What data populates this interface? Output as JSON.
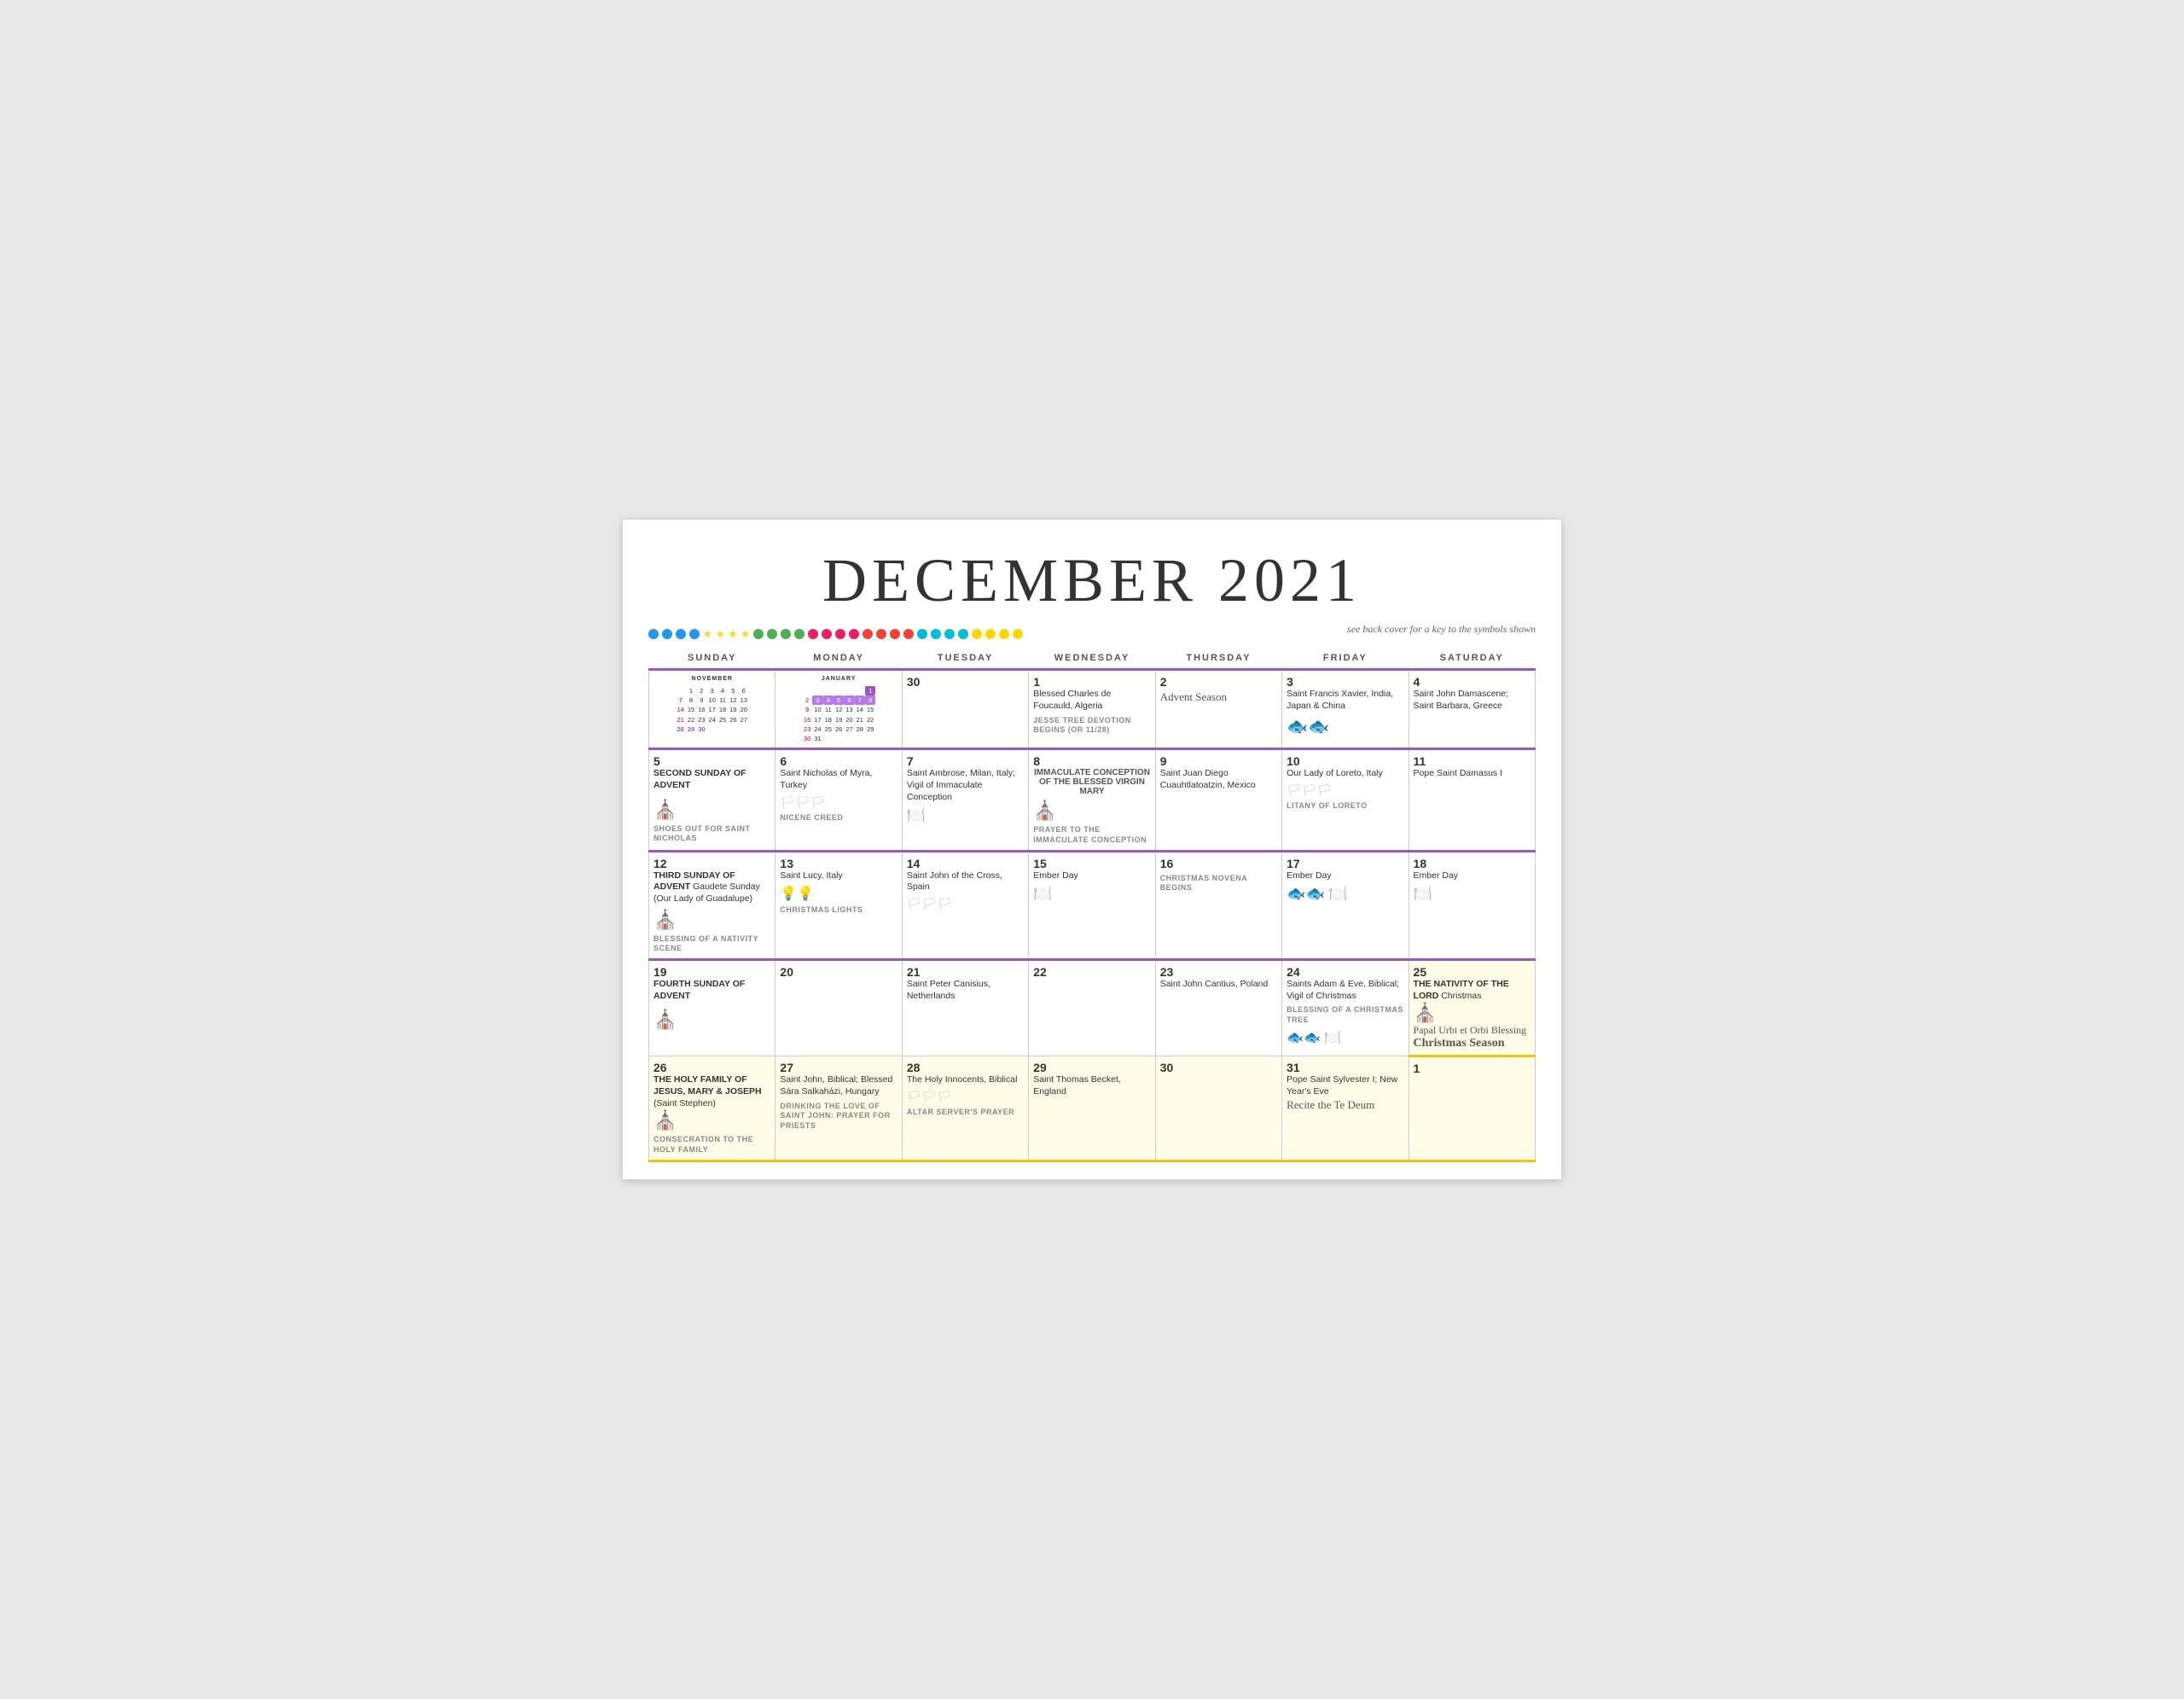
{
  "title": "DECEMBER 2021",
  "back_cover_note": "see back cover for a key to the symbols shown",
  "dots": [
    {
      "color": "#2196F3"
    },
    {
      "color": "#2196F3"
    },
    {
      "color": "#2196F3"
    },
    {
      "color": "#2196F3"
    },
    {
      "color": "#FFD700",
      "type": "star"
    },
    {
      "color": "#FFD700",
      "type": "star"
    },
    {
      "color": "#FFD700",
      "type": "star"
    },
    {
      "color": "#FFD700",
      "type": "star"
    },
    {
      "color": "#4CAF50"
    },
    {
      "color": "#4CAF50"
    },
    {
      "color": "#4CAF50"
    },
    {
      "color": "#4CAF50"
    },
    {
      "color": "#E91E63"
    },
    {
      "color": "#E91E63"
    },
    {
      "color": "#E91E63"
    },
    {
      "color": "#E91E63"
    },
    {
      "color": "#F44336"
    },
    {
      "color": "#F44336"
    },
    {
      "color": "#F44336"
    },
    {
      "color": "#F44336"
    },
    {
      "color": "#00BCD4"
    },
    {
      "color": "#00BCD4"
    },
    {
      "color": "#00BCD4"
    },
    {
      "color": "#00BCD4"
    },
    {
      "color": "#FFD700"
    },
    {
      "color": "#FFD700"
    },
    {
      "color": "#FFD700"
    },
    {
      "color": "#FFD700"
    }
  ],
  "headers": [
    "SUNDAY",
    "MONDAY",
    "TUESDAY",
    "WEDNESDAY",
    "THURSDAY",
    "FRIDAY",
    "SATURDAY"
  ],
  "weeks": [
    {
      "cells": [
        {
          "day": "",
          "mini_month": "NOVEMBER",
          "mini_rows": [
            [
              "",
              "1",
              "2",
              "3",
              "4",
              "5",
              "6"
            ],
            [
              "7",
              "8",
              "9",
              "10",
              "11",
              "12",
              "13"
            ],
            [
              "14",
              "15",
              "16",
              "17",
              "18",
              "19",
              "20"
            ],
            [
              "21",
              "22",
              "23",
              "24",
              "25",
              "26",
              "27"
            ],
            [
              "28",
              "29",
              "30",
              "",
              "",
              "",
              ""
            ]
          ],
          "sunday_col": 0
        },
        {
          "day": "",
          "mini_month": "JANUARY",
          "mini_rows": [
            [
              "",
              "",
              "",
              "",
              "",
              "",
              "1"
            ],
            [
              "2",
              "3",
              "4",
              "5",
              "6",
              "7",
              "8"
            ],
            [
              "9",
              "10",
              "11",
              "12",
              "13",
              "14",
              "15"
            ],
            [
              "16",
              "17",
              "18",
              "19",
              "20",
              "21",
              "22"
            ],
            [
              "23",
              "24",
              "25",
              "26",
              "27",
              "28",
              "29"
            ],
            [
              "30",
              "31",
              "",
              "",
              "",
              "",
              ""
            ]
          ],
          "highlight_col": 6,
          "highlight_row": 0,
          "purple_row": 1,
          "sunday_col": 0
        },
        {
          "day": "30",
          "saint": "",
          "activity": "",
          "icons": []
        },
        {
          "day": "1",
          "saint": "Blessed Charles de Foucauld, Algeria",
          "activity": "JESSE TREE DEVOTION BEGINS (OR 11/28)",
          "icons": []
        },
        {
          "day": "2",
          "saint": "",
          "cursive": "Advent Season",
          "icons": []
        },
        {
          "day": "3",
          "saint": "Saint Francis Xavier, India, Japan & China",
          "icons": [
            "fish"
          ]
        },
        {
          "day": "4",
          "saint": "Saint John Damascene; Saint Barbara, Greece",
          "icons": []
        }
      ],
      "border": "advent"
    },
    {
      "cells": [
        {
          "day": "5",
          "saint": "SECOND SUNDAY OF ADVENT",
          "activity": "SHOES OUT FOR SAINT NICHOLAS",
          "icons": [
            "church"
          ]
        },
        {
          "day": "6",
          "saint": "Saint Nicholas of Myra, Turkey",
          "activity": "NICENE CREED",
          "icons": [
            "pennants"
          ]
        },
        {
          "day": "7",
          "saint": "Saint Ambrose, Milan, Italy; Vigil of Immaculate Conception",
          "icons": [
            "plate"
          ]
        },
        {
          "day": "8",
          "saint": "IMMACULATE CONCEPTION OF THE BLESSED VIRGIN MARY",
          "activity": "PRAYER TO THE IMMACULATE CONCEPTION",
          "icons": [
            "church"
          ]
        },
        {
          "day": "9",
          "saint": "Saint Juan Diego Cuauhtlatoatzin, Mexico",
          "icons": []
        },
        {
          "day": "10",
          "saint": "Our Lady of Loreto, Italy",
          "activity": "LITANY OF LORETO",
          "icons": [
            "pennants"
          ]
        },
        {
          "day": "11",
          "saint": "Pope Saint Damasus I",
          "icons": []
        }
      ],
      "border": "advent"
    },
    {
      "cells": [
        {
          "day": "12",
          "saint": "THIRD SUNDAY OF ADVENT Gaudete Sunday (Our Lady of Guadalupe)",
          "activity": "BLESSING OF A NATIVITY SCENE",
          "icons": [
            "church"
          ]
        },
        {
          "day": "13",
          "saint": "Saint Lucy, Italy",
          "activity": "CHRISTMAS LIGHTS",
          "icons": [
            "lights"
          ]
        },
        {
          "day": "14",
          "saint": "Saint John of the Cross, Spain",
          "icons": [
            "pennants"
          ]
        },
        {
          "day": "15",
          "saint": "Ember Day",
          "icons": [
            "plate"
          ]
        },
        {
          "day": "16",
          "activity": "CHRISTMAS NOVENA BEGINS",
          "icons": []
        },
        {
          "day": "17",
          "saint": "Ember Day",
          "icons": [
            "fish",
            "plate"
          ]
        },
        {
          "day": "18",
          "saint": "Ember Day",
          "icons": [
            "plate"
          ]
        }
      ],
      "border": "advent"
    },
    {
      "cells": [
        {
          "day": "19",
          "saint": "FOURTH SUNDAY OF ADVENT",
          "icons": [
            "church"
          ]
        },
        {
          "day": "20",
          "saint": "",
          "icons": []
        },
        {
          "day": "21",
          "saint": "Saint Peter Canisius, Netherlands",
          "icons": []
        },
        {
          "day": "22",
          "saint": "",
          "icons": []
        },
        {
          "day": "23",
          "saint": "Saint John Cantius, Poland",
          "icons": []
        },
        {
          "day": "24",
          "saint": "Saints Adam & Eve, Biblical; Vigil of Christmas",
          "activity": "BLESSING OF A CHRISTMAS TREE",
          "icons": [
            "fish",
            "plate"
          ]
        },
        {
          "day": "25",
          "saint": "THE NATIVITY OF THE LORD Christmas",
          "cursive": "Papal Urbi et Orbi Blessing",
          "cursive2": "Christmas Season",
          "icons": [
            "church"
          ]
        }
      ],
      "border": "both"
    },
    {
      "cells": [
        {
          "day": "26",
          "saint": "THE HOLY FAMILY OF JESUS, MARY & JOSEPH (Saint Stephen)",
          "activity": "CONSECRATION TO THE HOLY FAMILY",
          "icons": [
            "church"
          ]
        },
        {
          "day": "27",
          "saint": "Saint John, Biblical; Blessed Sára Salkaházi, Hungary",
          "activity": "DRINKING THE LOVE OF SAINT JOHN: PRAYER FOR PRIESTS",
          "icons": []
        },
        {
          "day": "28",
          "saint": "The Holy Innocents, Biblical",
          "activity": "ALTAR SERVER'S PRAYER",
          "icons": [
            "pennants"
          ]
        },
        {
          "day": "29",
          "saint": "Saint Thomas Becket, England",
          "icons": []
        },
        {
          "day": "30",
          "saint": "",
          "icons": []
        },
        {
          "day": "31",
          "saint": "Pope Saint Sylvester I; New Year's Eve",
          "cursive": "Recite the Te Deum",
          "icons": []
        },
        {
          "day": "1",
          "saint": "",
          "icons": []
        }
      ],
      "border": "christmas"
    }
  ]
}
